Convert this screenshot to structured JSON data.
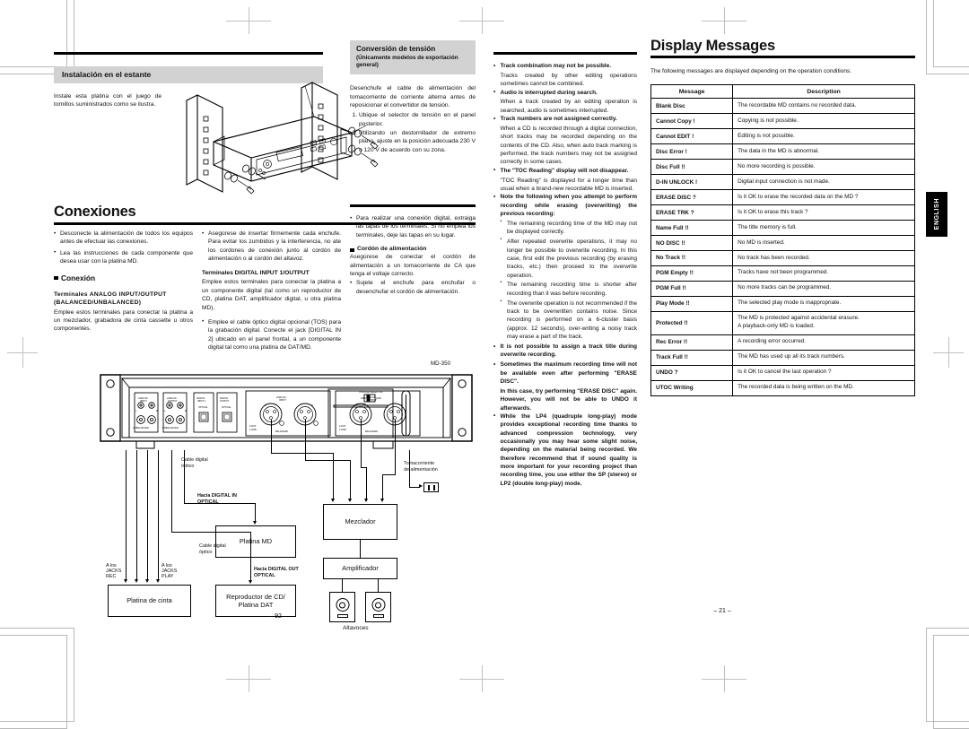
{
  "document": {
    "model": "MD-350",
    "left_page_number": "– 92 –",
    "right_page_number": "– 21 –",
    "side_tab": "ENGLISH"
  },
  "left_page": {
    "rack_install": {
      "heading": "Instalación en el estante",
      "body": "Instale esta platina con el juego de tornillos suministrados como se ilustra."
    },
    "connections": {
      "title": "Conexiones",
      "bullets": [
        "Desconecte la alimentación de todos los equipos antes de efectuar las conexiones.",
        "Lea las instrucciones de cada componente que desea usar con la platina MD."
      ],
      "connection_heading": "Conexión",
      "analog_heading": "Terminales ANALOG INPUT/OUTPUT (BALANCED/UNBALANCED)",
      "analog_body": "Emplee estos terminales para conectar la platina a un mezclador, grabadora de cinta cassette u otros componentes."
    },
    "middle_column": {
      "bullets_top": [
        "Asegúrese de insertar firmemente cada enchufe. Para evitar los zumbidos y la interferencia, no ate los cordones de conexión junto al cordón de alimentación o al cordón del altavoz."
      ],
      "digital_heading": "Terminales DIGITAL INPUT 1/OUTPUT",
      "digital_body": "Emplee estos terminales para conectar la platina a un componente digital (tal como un reproductor de CD, platina DAT, amplificador digital, u otra platina MD).",
      "optical_bullet": "Emplee el cable óptico digital opcional (TOS) para la grabación digital. Conecte el jack [DIGITAL IN 2] ubicado en el panel frontal, a un componente digital tal como una platina de DAT/MD."
    },
    "voltage": {
      "heading_line1": "Conversión de tensión",
      "heading_line2": "(Únicamente modelos de exportación general)",
      "body": "Desenchufe el cable de alimentación del tomacorriente de corriente alterna antes de reposicionar el convertidor de tensión.",
      "steps": [
        "Ubique el selector de tensión en el panel posterior.",
        "Utilizando un destornillador de extremo plano, ajuste en la posición adecuada 230 V o 120 V de acuerdo con su zona."
      ],
      "digital_note": "Para realizar una conexión digital, extraiga las tapas de los terminales. Si no emplea los terminales, deje las tapas en su lugar.",
      "power_heading": "Cordón de alimentación",
      "power_body": "Asegúrese de conectar el cordón de alimentación a un tomacorriente de CA que tenga el voltaje correcto.",
      "power_bullet": "Sujete el enchufe para enchufar o desenchufar el cordón de alimentación."
    },
    "diagram": {
      "model_label": "MD-350",
      "voltage_selector_label": "VOLTAGE SELECTOR",
      "boxes": {
        "tape_deck": "Platina de cinta",
        "md_deck": "Platina MD",
        "cd_dat": "Reproductor de CD/\nPlatina DAT",
        "mixer": "Mezclador",
        "amplifier": "Amplificador",
        "speakers": "Altavoces"
      },
      "labels": {
        "optical_cable_top": "Cable digital\nóptico",
        "optical_cable_bottom": "Cable digital\nóptico",
        "to_digital_in": "Hacia DIGITAL IN\nOPTICAL",
        "to_digital_out": "Hacia DIGITAL OUT\nOPTICAL",
        "jacks_rec": "A los\nJACKS\nREC",
        "jacks_play": "A los\nJACKS\nPLAY",
        "ac_outlet": "Tomacorriente\nde alimentación"
      }
    }
  },
  "right_page": {
    "notes_column": [
      {
        "style": "bold",
        "text": "Track combination may not be possible."
      },
      {
        "style": "plain-cont",
        "text": "Tracks created by other editing operations sometimes cannot be combined."
      },
      {
        "style": "bold",
        "text": "Audio is interrupted during search."
      },
      {
        "style": "plain-cont",
        "text": "When a track created by an editing operation is searched, audio is sometimes interrupted."
      },
      {
        "style": "bold",
        "text": "Track numbers are not assigned correctly."
      },
      {
        "style": "plain-cont",
        "text": "When a CD is recorded through a digital connection, short tracks may be recorded depending on the contents of the CD. Also, when auto track marking is performed, the track numbers may not be assigned correctly in some cases."
      },
      {
        "style": "bold",
        "text": "The \"TOC Reading\" display will not disappear."
      },
      {
        "style": "plain-cont",
        "text": "\"TOC Reading\" is displayed for a longer time than usual when a brand-new recordable MD is inserted."
      },
      {
        "style": "bold",
        "text": "Note the following when you attempt to perform recording while erasing (overwriting) the previous recording:"
      },
      {
        "style": "sub",
        "text": "The remaining recording time of the MD may not be displayed correctly."
      },
      {
        "style": "sub",
        "text": "After repeated overwrite operations, it may no longer be possible to overwrite recording. In this case, first edit the previous recording (by erasing tracks, etc.) then proceed to the overwrite operation."
      },
      {
        "style": "sub",
        "text": "The remaining recording time is shorter after recording than it was before recording."
      },
      {
        "style": "sub",
        "text": "The overwrite operation is not recommended if the track to be overwritten contains noise. Since recording is performed on a 6-cluster basis (approx. 12 seconds), over-writing a noisy track may erase a part of the track."
      },
      {
        "style": "bold",
        "text": "It is not possible to assign a track title during overwrite recording."
      },
      {
        "style": "bold",
        "text": "Sometimes the maximum recording time will not be available even after performing \"ERASE DISC\"."
      },
      {
        "style": "bold-cont",
        "text": "In this case, try performing \"ERASE DISC\" again. However, you will not be able to UNDO it afterwards."
      },
      {
        "style": "bold",
        "text": "While the LP4 (quadruple long-play) mode provides exceptional recording time thanks to advanced compression technology, very occasionally you may hear some slight noise, depending on the material being recorded. We therefore recommend that if sound quality is more important for your recording project than recording time, you use either the SP (stereo) or LP2 (double long-play) mode."
      }
    ],
    "display_messages": {
      "title": "Display Messages",
      "intro": "The following messages are displayed depending on the operation conditions.",
      "columns": [
        "Message",
        "Description"
      ],
      "rows": [
        {
          "message": "Blank Disc",
          "description": "The recordable MD contains no recorded data."
        },
        {
          "message": "Cannot Copy !",
          "description": "Copying is not possible."
        },
        {
          "message": "Cannot EDIT !",
          "description": "Editing is not possible."
        },
        {
          "message": "Disc Error !",
          "description": "The data in the MD is abnormal."
        },
        {
          "message": "Disc Full !!",
          "description": "No more recording is possible."
        },
        {
          "message": "D-IN UNLOCK !",
          "description": "Digital input connection is not made."
        },
        {
          "message": "ERASE DISC ?",
          "description": "Is it OK to erase the recorded data on the MD ?"
        },
        {
          "message": "ERASE TRK ?",
          "description": "Is it OK to erase this track ?"
        },
        {
          "message": "Name Full !!",
          "description": "The title memory is full."
        },
        {
          "message": "NO DISC !!",
          "description": "No MD is inserted."
        },
        {
          "message": "No Track !!",
          "description": "No track has been recorded."
        },
        {
          "message": "PGM Empty !!",
          "description": "Tracks have not been programmed."
        },
        {
          "message": "PGM Full !!",
          "description": "No more tracks can be programmed."
        },
        {
          "message": "Play Mode !!",
          "description": "The selected play mode is inappropriate."
        },
        {
          "message": "Protected !!",
          "description": "The MD is protected against accidental erasure.\nA playback-only MD is loaded."
        },
        {
          "message": "Rec Error !!",
          "description": "A recording error occurred."
        },
        {
          "message": "Track Full !!",
          "description": "The MD has used up all its track numbers."
        },
        {
          "message": "UNDO ?",
          "description": "Is it OK to cancel the last operation ?"
        },
        {
          "message": "UTOC Writing",
          "description": "The recorded data is being written on the MD."
        }
      ]
    }
  }
}
